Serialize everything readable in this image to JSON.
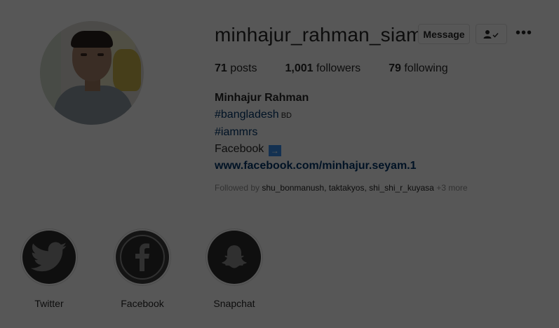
{
  "profile": {
    "username": "minhajur_rahman_siam",
    "message_label": "Message",
    "more_label": "•••",
    "posts_count": "71",
    "posts_label": " posts",
    "followers_count": "1,001",
    "followers_label": " followers",
    "following_count": "79",
    "following_label": " following"
  },
  "bio": {
    "full_name": "Minhajur Rahman",
    "hashtag1": "#bangladesh",
    "hashtag1_suffix": " BD",
    "hashtag2": "#iammrs",
    "line_facebook": "Facebook ",
    "arrow": "→",
    "website": "www.facebook.com/minhajur.seyam.1"
  },
  "followed_by": {
    "prefix": "Followed by ",
    "names": "shu_bonmanush, taktakyos, shi_shi_r_kuyasa",
    "more": " +3 more"
  },
  "highlights": [
    {
      "label": "Twitter",
      "icon": "twitter-bird-icon"
    },
    {
      "label": "Facebook",
      "icon": "facebook-f-icon"
    },
    {
      "label": "Snapchat",
      "icon": "snapchat-ghost-icon"
    }
  ],
  "colors": {
    "link_blue": "#003569",
    "overlay": "rgba(0,0,0,0.65)"
  }
}
